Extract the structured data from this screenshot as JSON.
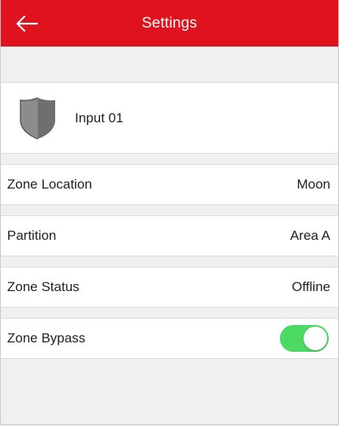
{
  "appbar": {
    "title": "Settings",
    "back_icon": "arrow-left-icon",
    "color": "#e0121d"
  },
  "zone": {
    "name": "Input 01",
    "icon": "shield-icon"
  },
  "rows": [
    {
      "label": "Zone Location",
      "value": "Moon"
    },
    {
      "label": "Partition",
      "value": "Area A"
    },
    {
      "label": "Zone Status",
      "value": "Offline"
    }
  ],
  "bypass": {
    "label": "Zone Bypass",
    "enabled": true,
    "toggle_color": "#4cd964"
  }
}
